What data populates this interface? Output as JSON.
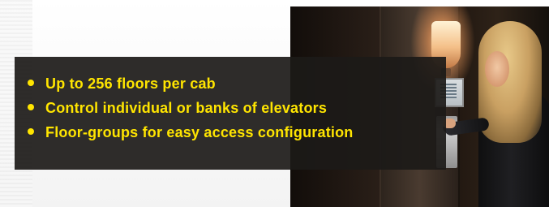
{
  "features": {
    "items": [
      {
        "label": "Up to 256 floors per cab"
      },
      {
        "label": "Control individual or banks of elevators"
      },
      {
        "label": "Floor-groups for easy access configuration"
      }
    ]
  },
  "colors": {
    "text_accent": "#ffe500",
    "overlay_bg": "#1c1a18",
    "page_bg": "#f3f3f3"
  },
  "icons": {
    "bullet": "bullet-dot-icon"
  }
}
